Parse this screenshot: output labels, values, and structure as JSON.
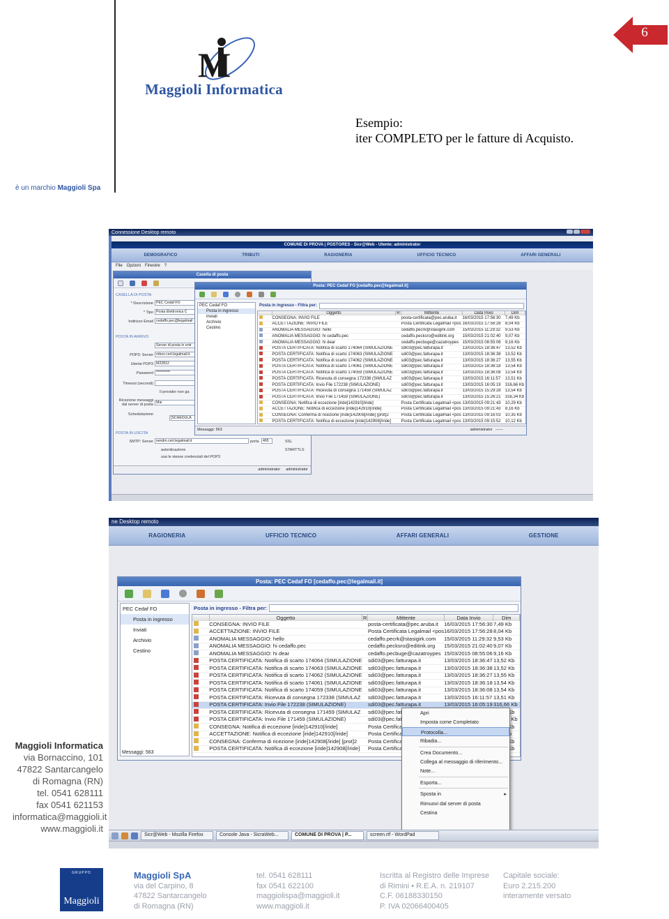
{
  "header": {
    "brand": "Maggioli Informatica",
    "trademark_prefix": "è un marchio ",
    "trademark_company": "Maggioli Spa",
    "page_number": "6"
  },
  "slide": {
    "title_line1": "Esempio:",
    "title_line2": "iter COMPLETO per le fatture di Acquisto."
  },
  "screenshot1": {
    "window_title": "Connessione Desktop remoto",
    "app_title": "COMUNE DI PROVA | POSTGRES - Sicr@Web - Utente: administrator",
    "nav": [
      "DEMOGRAFICO",
      "TRIBUTI",
      "RAGIONERIA",
      "UFFICIO TECNICO",
      "AFFARI GENERALI"
    ],
    "menu": [
      "File",
      "Opzioni",
      "Finestre",
      "?"
    ],
    "mailbox_title": "Casella di posta",
    "form": {
      "sec_casella": "CASELLA DI POSTA",
      "descrizione_lbl": "* Descrizione",
      "descrizione_val": "PEC Cedaf FO",
      "tipo_lbl": "* Tipo",
      "tipo_val": "Posta Elettronica C",
      "indirizzo_lbl": "Indirizzo Email",
      "indirizzo_val": "cedaffo.pec@legalmail",
      "sec_arrivo": "POSTA IN ARRIVO",
      "tipo_server": "Server di posta in entr",
      "pop3_lbl": "POP3: Server",
      "pop3_val": "mbox.cert.legalmail.it",
      "utente_lbl": "Utente POP3",
      "utente_val": "M22812",
      "password_lbl": "Password",
      "password_val": "**********",
      "timeout_lbl": "Timeout (secondi)",
      "provider_lbl": "Il provider non ga",
      "ricezione_lbl": "Ricezione messaggi dal server di posta",
      "ricezione_val": "Mai",
      "schedulazione_lbl": "Schedulazione",
      "schedulazione_val": "[SCHEDULA",
      "sec_uscita": "POSTA IN USCITA",
      "smtp_lbl": "SMTP: Server",
      "smtp_val": "sendm.cert.legalmail.it",
      "porta_lbl": "porta",
      "porta_val": "465",
      "ssl": "SSL",
      "starttls": "STARTTLS",
      "autenticazione": "autenticazione",
      "usa_credenziali": "usa le stesse credenziali del POP3",
      "user1": "administrator",
      "user2": "administrator"
    },
    "status_user": "administrator",
    "status_extra": "------"
  },
  "screenshot2": {
    "window_title": "ne Desktop remoto",
    "nav": [
      "RAGIONERIA",
      "UFFICIO TECNICO",
      "AFFARI GENERALI",
      "GESTIONE"
    ],
    "taskbar": [
      "Sicr@Web - Mozilla Firefox",
      "Console Java - SicraWeb...",
      "COMUNE DI PROVA | P...",
      "screen.rtf - WordPad"
    ]
  },
  "mail": {
    "window_title": "Posta: PEC Cedaf FO [cedaffo.pec@legalmail.it]",
    "filter_label": "Posta in ingresso - Filtra per:",
    "tree": [
      "PEC Cedaf FO",
      "Posta in ingresso",
      "Inviati",
      "Archivio",
      "Cestino"
    ],
    "columns": [
      "Oggetto",
      "R",
      "Mittente",
      "Data Invio",
      "Dim"
    ],
    "rows": [
      [
        "CONSEGNA: INVIO FILE",
        "posta-certificata@pec.aruba.it",
        "16/03/2015 17:56:30",
        "7,49 Kb"
      ],
      [
        "ACCETTAZIONE: INVIO FILE",
        "Posta Certificata Legalmail <pos",
        "16/03/2015 17:56:28",
        "8,04 Kb"
      ],
      [
        "ANOMALIA MESSAGGIO: hello",
        "cedaffo.pecrk@stasigirk.com",
        "15/03/2015 11:29:32",
        "9,53 Kb"
      ],
      [
        "ANOMALIA MESSAGGIO: hi cedaffo.pec",
        "cedaffo.pecksro@editink.org",
        "15/03/2015 21:02:40",
        "9,07 Kb"
      ],
      [
        "ANOMALIA MESSAGGIO: hi dear",
        "cedaffo.pecbuge@cazatroypes",
        "15/03/2015 08:55:06",
        "9,16 Kb"
      ],
      [
        "POSTA CERTIFICATA: Notifica di scarto 174064 (SIMULAZIONE",
        "sdi03@pec.fatturapa.it",
        "13/03/2015 18:36:47",
        "13,52 Kb"
      ],
      [
        "POSTA CERTIFICATA: Notifica di scarto 174063 (SIMULAZIONE",
        "sdi03@pec.fatturapa.it",
        "13/03/2015 18:36:38",
        "13,52 Kb"
      ],
      [
        "POSTA CERTIFICATA: Notifica di scarto 174062 (SIMULAZIONE",
        "sdi03@pec.fatturapa.it",
        "13/03/2015 18:36:27",
        "13,55 Kb"
      ],
      [
        "POSTA CERTIFICATA: Notifica di scarto 174061 (SIMULAZIONE",
        "sdi03@pec.fatturapa.it",
        "13/03/2015 18:36:18",
        "13,54 Kb"
      ],
      [
        "POSTA CERTIFICATA: Notifica di scarto 174059 (SIMULAZIONE",
        "sdi03@pec.fatturapa.it",
        "13/03/2015 18:36:08",
        "13,54 Kb"
      ],
      [
        "POSTA CERTIFICATA: Ricevuta di consegna 172338 (SIMULAZ",
        "sdi03@pec.fatturapa.it",
        "13/03/2015 16:11:57",
        "13,51 Kb"
      ],
      [
        "POSTA CERTIFICATA: Invio File 172238 (SIMULAZIONE)",
        "sdi03@pec.fatturapa.it",
        "13/03/2015 16:05:19",
        "316,66 Kb"
      ],
      [
        "POSTA CERTIFICATA: Ricevuta di consegna 171459 (SIMULAZ",
        "sdi03@pec.fatturapa.it",
        "13/03/2015 15:29:28",
        "13,54 Kb"
      ],
      [
        "POSTA CERTIFICATA: Invio File 171459 (SIMULAZIONE)",
        "sdi03@pec.fatturapa.it",
        "13/03/2015 15:26:21",
        "316,34 Kb"
      ],
      [
        "CONSEGNA: Notifica di eccezione [iride]142910[/iride]",
        "Posta Certificata Legalmail <pos",
        "13/03/2015 09:21:43",
        "10,29 Kb"
      ],
      [
        "ACCETTAZIONE: Notifica di eccezione [iride]142910[/iride]",
        "Posta Certificata Legalmail <pos",
        "13/03/2015 09:21:43",
        "8,16 Kb"
      ],
      [
        "CONSEGNA: Conferma di ricezione [iride]142908[/iride] [prot]2",
        "Posta Certificata Legalmail <pos",
        "13/03/2015 09:16:03",
        "10,35 Kb"
      ],
      [
        "POSTA CERTIFICATA: Notifica di eccezione [iride]142908[/iride]",
        "Posta Certificata Legalmail <pos",
        "13/03/2015 09:15:52",
        "10,12 Kb"
      ]
    ],
    "messages": "Messaggi: 563"
  },
  "context_menu": [
    "Apri",
    "Imposta come Completato",
    "Protocolla...",
    "Ribadia...",
    "Crea Documento...",
    "Collega al messaggio di riferimento...",
    "Note...",
    "Esporta...",
    "Sposta in",
    "Rimuovi dal server di posta",
    "Cestina"
  ],
  "address": {
    "name": "Maggioli Informatica",
    "street": "via Bornaccino, 101",
    "city": "47822 Santarcangelo",
    "city2": "di Romagna (RN)",
    "tel": "tel. 0541 628111",
    "fax": "fax 0541 621153",
    "email": "informatica@maggioli.it",
    "web": "www.maggioli.it"
  },
  "footer": {
    "logo_small": "GRUPPO",
    "logo_text": "Maggioli",
    "company": "Maggioli SpA",
    "street": "via del Carpino, 8",
    "city": "47822 Santarcangelo",
    "city2": "di Romagna (RN)",
    "tel": "tel. 0541 628111",
    "fax": "fax 0541 622100",
    "email": "maggiolispa@maggioli.it",
    "web": "www.maggioli.it",
    "reg1": "Iscritta al Registro delle Imprese",
    "reg2": "di Rimini • R.E.A. n. 219107",
    "reg3": "C.F. 06188330150",
    "reg4": "P. IVA 02066400405",
    "cap1": "Capitale sociale:",
    "cap2": "Euro 2.215.200",
    "cap3": "interamente versato"
  },
  "colors": {
    "brand_blue": "#2d55a0",
    "badge_red": "#c8282e",
    "nav_blue": "#25447b"
  }
}
